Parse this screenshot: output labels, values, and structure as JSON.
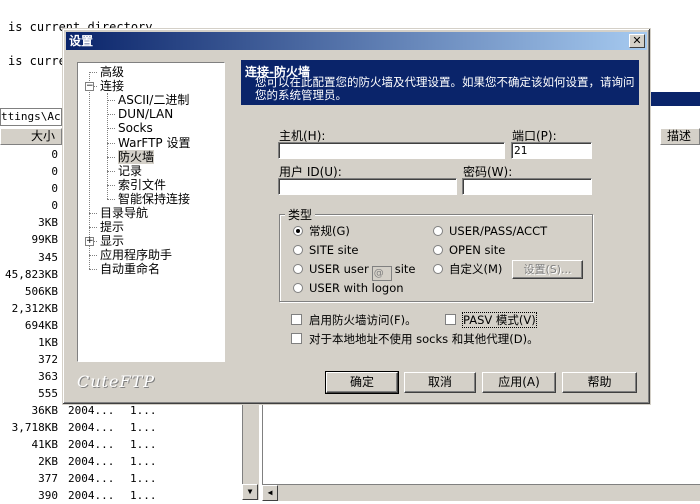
{
  "background": {
    "log_lines": [
      "is current directory",
      "is current directory"
    ],
    "path_fragment": "ttings\\Ac",
    "size_header": "大小",
    "right_header": "描述",
    "sizes": [
      "0",
      "0",
      "0",
      "0",
      "3KB",
      "99KB",
      "345",
      "45,823KB",
      "506KB",
      "2,312KB",
      "694KB",
      "1KB",
      "372",
      "363",
      "555"
    ],
    "lower_rows": [
      {
        "size": "36KB",
        "date": "2004...",
        "attr": "1..."
      },
      {
        "size": "3,718KB",
        "date": "2004...",
        "attr": "1..."
      },
      {
        "size": "41KB",
        "date": "2004...",
        "attr": "1..."
      },
      {
        "size": "2KB",
        "date": "2004...",
        "attr": "1..."
      },
      {
        "size": "377",
        "date": "2004...",
        "attr": "1..."
      },
      {
        "size": "390",
        "date": "2004...",
        "attr": "1..."
      }
    ]
  },
  "dialog": {
    "title": "设置",
    "logo": "CuteFTP",
    "tree": [
      {
        "label": "高级",
        "level": 1
      },
      {
        "label": "连接",
        "level": 1,
        "expander": "−"
      },
      {
        "label": "ASCII/二进制",
        "level": 2
      },
      {
        "label": "DUN/LAN",
        "level": 2
      },
      {
        "label": "Socks",
        "level": 2
      },
      {
        "label": "WarFTP 设置",
        "level": 2
      },
      {
        "label": "防火墙",
        "level": 2,
        "selected": true
      },
      {
        "label": "记录",
        "level": 2
      },
      {
        "label": "索引文件",
        "level": 2
      },
      {
        "label": "智能保持连接",
        "level": 2
      },
      {
        "label": "目录导航",
        "level": 1
      },
      {
        "label": "提示",
        "level": 1
      },
      {
        "label": "显示",
        "level": 1,
        "expander": "+"
      },
      {
        "label": "应用程序助手",
        "level": 1
      },
      {
        "label": "自动重命名",
        "level": 1
      }
    ],
    "banner": {
      "title": "连接-防火墙",
      "desc": "您可以在此配置您的防火墙及代理设置。如果您不确定该如何设置，请询问您的系统管理员。"
    },
    "fields": {
      "host_label": "主机(H):",
      "host_value": "",
      "port_label": "端口(P):",
      "port_value": "21",
      "userid_label": "用户 ID(U):",
      "userid_value": "",
      "password_label": "密码(W):",
      "password_value": ""
    },
    "type_group": {
      "legend": "类型",
      "options": {
        "normal": "常规(G)",
        "site": "SITE site",
        "user_user": "USER user",
        "at_value": "@",
        "site_suffix": "site",
        "user_logon": "USER with logon",
        "user_pass_acct": "USER/PASS/ACCT",
        "open_site": "OPEN site",
        "custom": "自定义(M)",
        "settings_btn": "设置(S)..."
      }
    },
    "checks": {
      "enable_firewall": "启用防火墙访问(F)。",
      "pasv": "PASV 模式(V)",
      "no_socks_local": "对于本地地址不使用 socks 和其他代理(D)。"
    },
    "buttons": {
      "ok": "确定",
      "cancel": "取消",
      "apply": "应用(A)",
      "help": "帮助"
    }
  }
}
